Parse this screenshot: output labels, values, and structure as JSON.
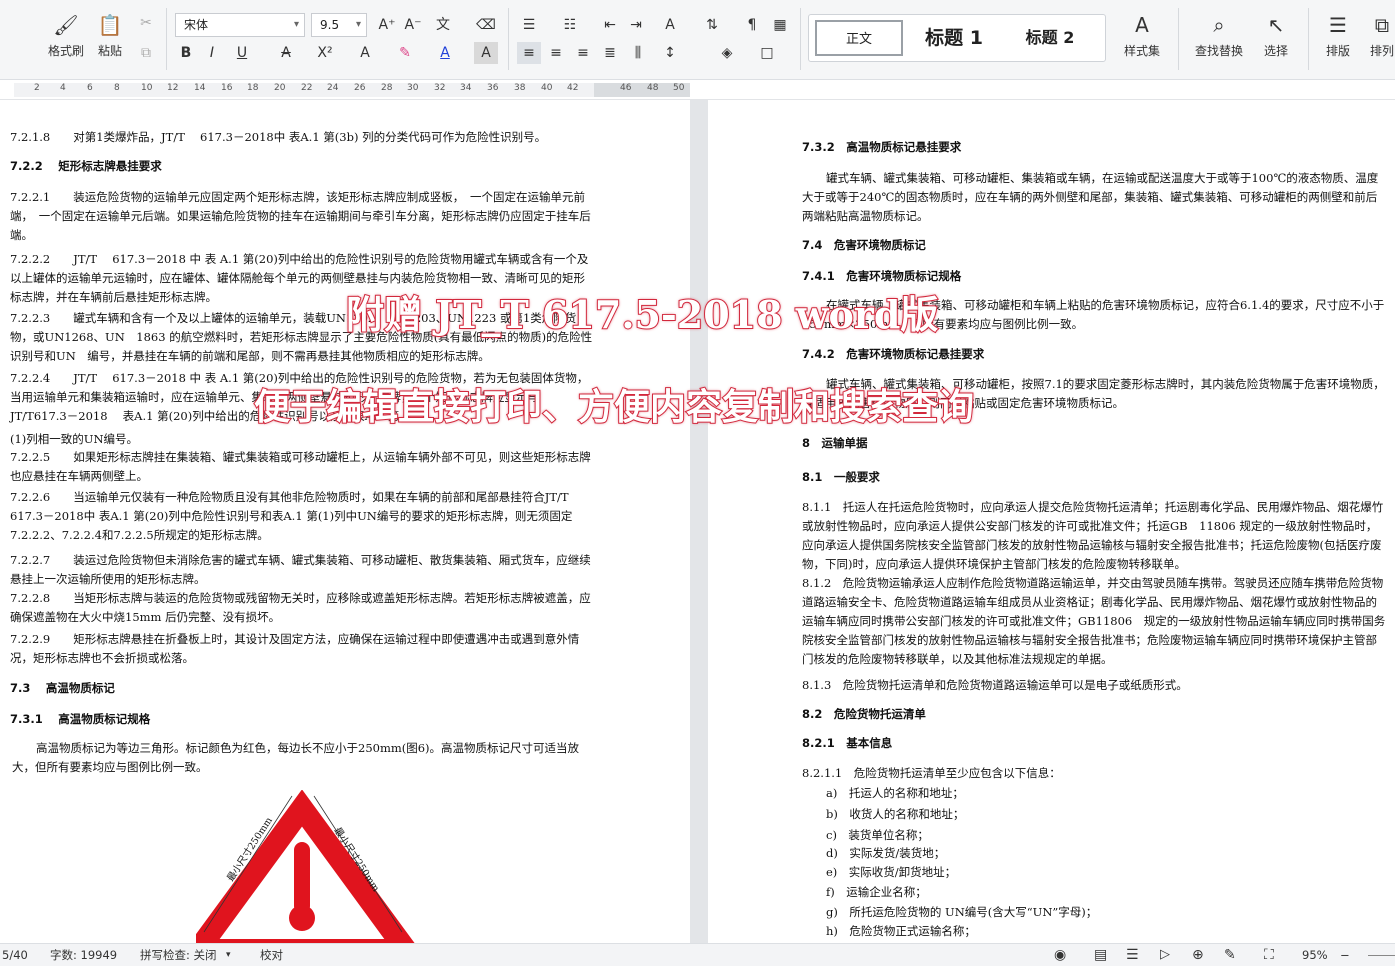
{
  "toolbar": {
    "format_painter": "格式刷",
    "paste": "粘贴",
    "font_name": "宋体",
    "font_size": "9.5",
    "styles": [
      "正文",
      "标题 1",
      "标题 2"
    ],
    "style_set": "样式集",
    "find_replace": "查找替换",
    "select": "选择",
    "layout": "排版",
    "arrange": "排列"
  },
  "ruler": [
    "2",
    "4",
    "6",
    "8",
    "10",
    "12",
    "14",
    "16",
    "18",
    "20",
    "22",
    "24",
    "26",
    "28",
    "30",
    "32",
    "34",
    "36",
    "38",
    "40",
    "42",
    "46",
    "48",
    "50"
  ],
  "left_page": {
    "p1": "7.2.1.8　　对第1类爆炸品，JT/T　 617.3－2018中 表A.1 第(3b) 列的分类代码可作为危险性识别号。",
    "h1": "7.2.2　 矩形标志牌悬挂要求",
    "p2": "7.2.2.1　　装运危险货物的运输单元应固定两个矩形标志牌，该矩形标志牌应制成竖板，　一个固定在运输单元前端，　一个固定在运输单元后端。如果运输危险货物的挂车在运输期间与牵引车分离，矩形标志牌仍应固定于挂车后端。",
    "p3": "7.2.2.2　　JT/T　 617.3－2018 中 表 A.1 第(20)列中给出的危险性识别号的危险货物用罐式车辆或含有一个及以上罐体的运输单元运输时，应在罐体、罐体隔舱每个单元的两侧壁悬挂与内装危险货物相一致、清晰可见的矩形标志牌，并在车辆前后悬挂矩形标志牌。",
    "p4": "7.2.2.3　　罐式车辆和含有一个及以上罐体的运输单元，装载UN1202、UN1203、UN1223 或第1类危险货物，或UN1268、UN　1863 的航空燃料时，若矩形标志牌显示了主要危险性物质(具有最低闪点的物质)的危险性识别号和UN　编号，并悬挂在车辆的前端和尾部，则不需再悬挂其他物质相应的矩形标志牌。",
    "p5": "7.2.2.4　　JT/T　 617.3－2018 中 表 A.1 第(20)列中给出的危险性识别号的危险货物，若为无包装固体货物，当用运输单元和集装箱运输时，应在运输单元、集装箱两侧壁悬挂矩形标志牌，每个矩形标志牌应显示与JT/T617.3－2018　 表A.1 第(20)列中给出的危险性识别号以及　表A.1 第",
    "p6": "(1)列相一致的UN编号。",
    "p7": "7.2.2.5　　如果矩形标志牌挂在集装箱、罐式集装箱或可移动罐柜上，从运输车辆外部不可见，则这些矩形标志牌也应悬挂在车辆两侧壁上。",
    "p8": "7.2.2.6　　当运输单元仅装有一种危险物质且没有其他非危险物质时，如果在车辆的前部和尾部悬挂符合JT/T　 617.3－2018中 表A.1 第(20)列中危险性识别号和表A.1 第(1)列中UN编号的要求的矩形标志牌，则无须固定7.2.2.2、7.2.2.4和7.2.2.5所规定的矩形标志牌。",
    "p9": "7.2.2.7　　装运过危险货物但未消除危害的罐式车辆、罐式集装箱、可移动罐柜、散货集装箱、厢式货车，应继续悬挂上一次运输所使用的矩形标志牌。",
    "p10": "7.2.2.8　　当矩形标志牌与装运的危险货物或残留物无关时，应移除或遮盖矩形标志牌。若矩形标志牌被遮盖，应确保遮盖物在大火中烧15mm 后仍完整、没有损坏。",
    "p11": "7.2.2.9　　矩形标志牌悬挂在折叠板上时，其设计及固定方法，应确保在运输过程中即使遭遇冲击或遇到意外情况，矩形标志牌也不会折损或松落。",
    "h2": "7.3　 高温物质标记",
    "h3": "7.3.1　 高温物质标记规格",
    "p12": "高温物质标记为等边三角形。标记颜色为红色，每边长不应小于250mm(图6)。高温物质标记尺寸可适当放大，但所有要素均应与图例比例一致。",
    "fig_left": "最小尺寸250mm",
    "fig_right": "最小尺寸250mm"
  },
  "right_page": {
    "h1": "7.3.2　高温物质标记悬挂要求",
    "p1": "罐式车辆、罐式集装箱、可移动罐柜、集装箱或车辆，在运输或配送温度大于或等于100℃的液态物质、温度大于或等于240℃的固态物质时，应在车辆的两外侧壁和尾部，集装箱、罐式集装箱、可移动罐柜的两侧壁和前后两端粘贴高温物质标记。",
    "h2": "7.4　危害环境物质标记",
    "h3": "7.4.1　危害环境物质标记规格",
    "p2": "在罐式车辆、罐式集装箱、可移动罐柜和车辆上粘贴的危害环境物质标记，应符合6.1.4的要求，尺寸应不小于250mm×250mm，且所有要素均应与图例比例一致。",
    "h4": "7.4.2　危害环境物质标记悬挂要求",
    "p3": "罐式车辆、罐式集装箱、可移动罐柜，按照7.1的要求固定菱形标志牌时，其内装危险货物属于危害环境物质，且适用于危害环境物质，则同时粘贴或固定危害环境物质标记。",
    "h5": "8　运输单据",
    "h6": "8.1　一般要求",
    "p4": "8.1.1　托运人在托运危险货物时，应向承运人提交危险货物托运清单；托运剧毒化学品、民用爆炸物品、烟花爆竹或放射性物品时，应向承运人提供公安部门核发的许可或批准文件；托运GB　11806 规定的一级放射性物品时，应向承运人提供国务院核安全监管部门核发的放射性物品运输核与辐射安全报告批准书；托运危险废物(包括医疗废物，下同)时，应向承运人提供环境保护主管部门核发的危险废物转移联单。",
    "p5": "8.1.2　危险货物运输承运人应制作危险货物道路运输运单，并交由驾驶员随车携带。驾驶员还应随车携带危险货物道路运输安全卡、危险货物道路运输车组成员从业资格证；剧毒化学品、民用爆炸物品、烟花爆竹或放射性物品的运输车辆应同时携带公安部门核发的许可或批准文件；GB11806　规定的一级放射性物品运输车辆应同时携带国务院核安全监管部门核发的放射性物品运输核与辐射安全报告批准书；危险废物运输车辆应同时携带环境保护主管部门核发的危险废物转移联单，以及其他标准法规规定的单据。",
    "p6": "8.1.3　危险货物托运清单和危险货物道路运输运单可以是电子或纸质形式。",
    "h7": "8.2　危险货物托运清单",
    "h8": "8.2.1　基本信息",
    "p7": "8.2.1.1　危险货物托运清单至少应包含以下信息：",
    "list": [
      "a)　托运人的名称和地址；",
      "b)　收货人的名称和地址；",
      "c)　装货单位名称；",
      "d)　实际发货/装货地；",
      "e)　实际收货/卸货地址；",
      "f)　运输企业名称；",
      "g)　所托运危险货物的 UN编号(含大写“UN”字母)；",
      "h)　危险货物正式运输名称；"
    ]
  },
  "watermark": {
    "line1": "附赠 JT_T 617.5-2018 word版",
    "line2": "便于编辑直接打印、方便内容复制和搜索查询"
  },
  "status": {
    "page": "5/40",
    "word_count": "字数: 19949",
    "spell_check": "拼写检查: 关闭",
    "proofread": "校对",
    "zoom": "95%"
  }
}
